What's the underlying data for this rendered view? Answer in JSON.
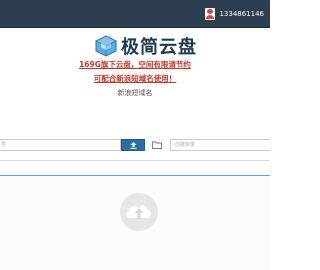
{
  "navbar": {
    "username": "1334861146",
    "background_color": "#2c3e50",
    "user_icon": "user-avatar-icon"
  },
  "logo": {
    "text": "极简云盘",
    "icon": "cube-cloud-logo-icon",
    "color": "#1e3a4f"
  },
  "promo": {
    "line1": "169G旗下云盘，空间有限请节约",
    "line2": "可配合新浪短域名使用！",
    "color": "#c0392b"
  },
  "new_domain_label": "新浪短域名",
  "toolbar": {
    "file_input_placeholder": "号",
    "upload_button_icon": "upload-icon",
    "folder_icon": "folder-icon",
    "dir_input_placeholder": "创建目录",
    "upload_button_color": "#2e6da4"
  },
  "drop_zone": {
    "icon": "cloud-upload-icon",
    "accent_color": "#5aa9e6"
  }
}
